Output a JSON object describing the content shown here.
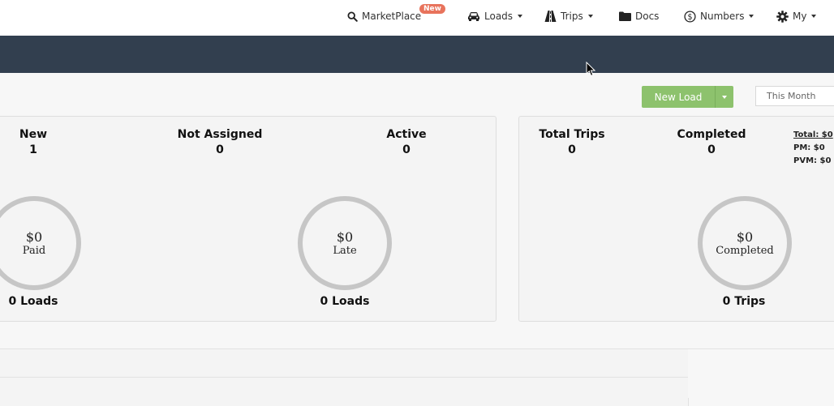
{
  "nav": {
    "marketplace": {
      "label": "MarketPlace",
      "badge": "New",
      "icon": "search-icon"
    },
    "loads": {
      "label": "Loads",
      "icon": "car-icon"
    },
    "trips": {
      "label": "Trips",
      "icon": "road-icon"
    },
    "docs": {
      "label": "Docs",
      "icon": "folder-icon"
    },
    "numbers": {
      "label": "Numbers",
      "icon": "dollar-circle-icon"
    },
    "my": {
      "label": "My",
      "icon": "gear-icon"
    }
  },
  "toolbar": {
    "new_load_label": "New Load",
    "period_select": "This Month"
  },
  "loads_panel": {
    "stats": [
      {
        "label": "New",
        "value": "1"
      },
      {
        "label": "Not Assigned",
        "value": "0"
      },
      {
        "label": "Active",
        "value": "0"
      }
    ],
    "rings": [
      {
        "amount": "$0",
        "label": "Paid",
        "footer": "0 Loads"
      },
      {
        "amount": "$0",
        "label": "Late",
        "footer": "0 Loads"
      }
    ]
  },
  "trips_panel": {
    "stats": [
      {
        "label": "Total Trips",
        "value": "0"
      },
      {
        "label": "Completed",
        "value": "0"
      }
    ],
    "summary": {
      "total": "Total: $0",
      "pm": "PM: $0",
      "pvm": "PVM: $0"
    },
    "ring": {
      "amount": "$0",
      "label": "Completed",
      "footer": "0 Trips"
    }
  },
  "colors": {
    "banner": "#323f4f",
    "accent_green": "#8dc26d",
    "badge": "#e8735c",
    "ring": "#c6c6c6"
  }
}
